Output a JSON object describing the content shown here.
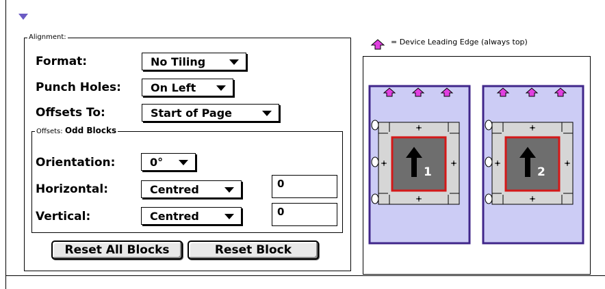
{
  "alignment": {
    "legend": "Alignment:",
    "format": {
      "label": "Format:",
      "value": "No Tiling"
    },
    "punch_holes": {
      "label": "Punch Holes:",
      "value": "On Left"
    },
    "offsets_to": {
      "label": "Offsets To:",
      "value": "Start of Page"
    }
  },
  "offsets": {
    "legend_prefix": "Offsets:",
    "legend_value": "Odd Blocks",
    "orientation": {
      "label": "Orientation:",
      "value": "0°"
    },
    "horizontal": {
      "label": "Horizontal:",
      "value": "Centred",
      "offset": "0"
    },
    "vertical": {
      "label": "Vertical:",
      "value": "Centred",
      "offset": "0"
    }
  },
  "buttons": {
    "reset_all": "Reset All Blocks",
    "reset": "Reset Block"
  },
  "preview": {
    "legend_text": "= Device Leading Edge (always top)",
    "page_numbers": [
      "1",
      "2"
    ],
    "colors": {
      "page": "#ccccf5",
      "border": "#40268a",
      "arrow": "#e040e0",
      "block": "#d6d6d6",
      "image": "#6e6e6e",
      "frame": "#d41818"
    }
  }
}
